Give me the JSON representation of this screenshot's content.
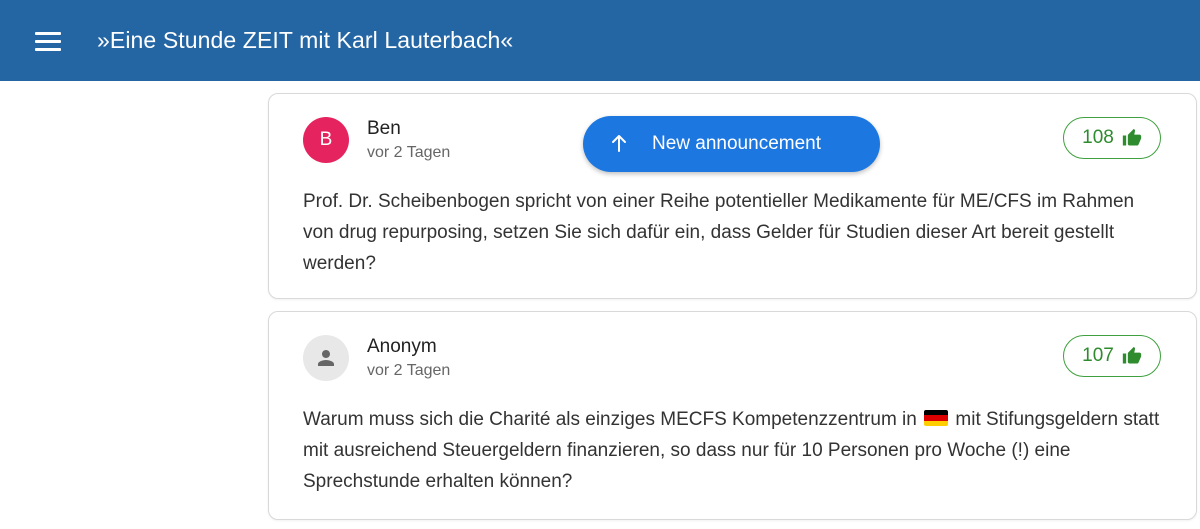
{
  "header": {
    "title": "»Eine Stunde ZEIT mit Karl Lauterbach«",
    "menu_icon": "hamburger-menu-icon"
  },
  "announcement": {
    "label": "New announcement",
    "icon": "arrow-up-icon"
  },
  "comments": [
    {
      "avatar_letter": "B",
      "avatar_color": "#e5245f",
      "author": "Ben",
      "time": "vor 2 Tagen",
      "likes": "108",
      "text": "Prof. Dr. Scheibenbogen spricht von einer Reihe potentieller Medikamente für ME/CFS im Rahmen von drug repurposing, setzen Sie sich dafür ein, dass Gelder für Studien dieser Art bereit gestellt werden?"
    },
    {
      "avatar_icon": "person-icon",
      "author": "Anonym",
      "time": "vor 2 Tagen",
      "likes": "107",
      "text_before_flag": "Warum muss sich die Charité als einziges MECFS Kompetenzzentrum in ",
      "flag": "german-flag-icon",
      "text_after_flag": " mit Stifungsgeldern statt mit ausreichend Steuergeldern finanzieren, so dass nur für 10 Personen pro Woche (!) eine Sprechstunde erhalten können?"
    }
  ],
  "colors": {
    "header_bg": "#2465a4",
    "announce_bg": "#1d77e0",
    "like_green": "#2e8b2e"
  }
}
